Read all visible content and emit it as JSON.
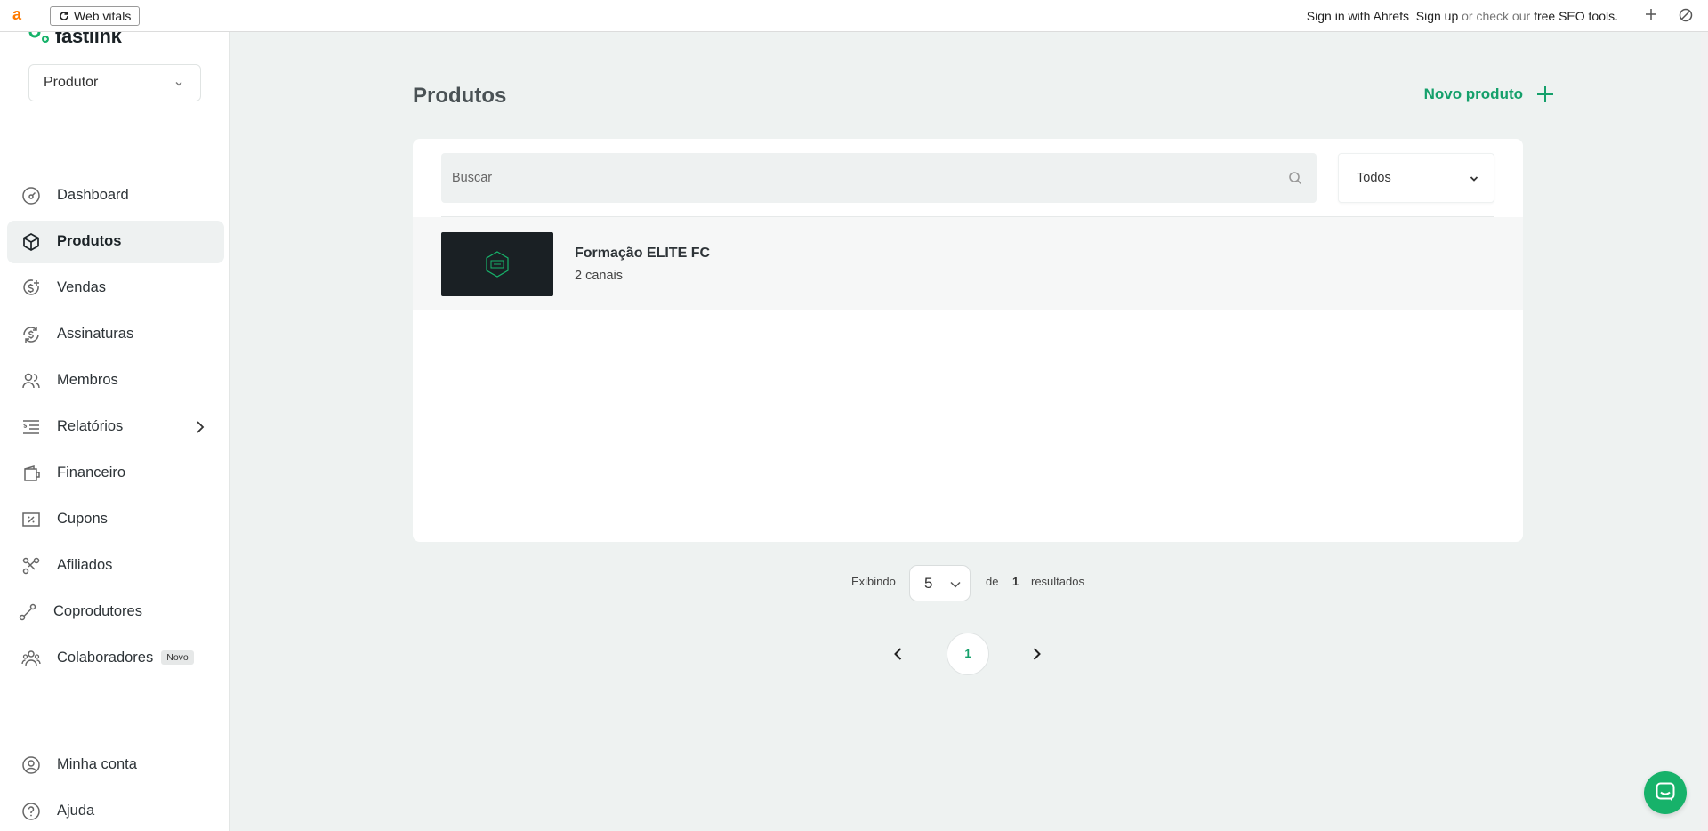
{
  "extension_bar": {
    "logo_letter": "a",
    "web_vitals_label": "Web vitals",
    "sign_in": "Sign in with Ahrefs",
    "sign_up": "Sign up",
    "or_check": "or check our",
    "free_tools": "free SEO tools."
  },
  "brand": {
    "name": "fastlink",
    "color": "#17b26a"
  },
  "sidebar": {
    "role_select": "Produtor",
    "items": [
      {
        "label": "Dashboard",
        "icon": "dashboard-icon"
      },
      {
        "label": "Produtos",
        "icon": "box-icon",
        "active": true
      },
      {
        "label": "Vendas",
        "icon": "dollar-plus-icon"
      },
      {
        "label": "Assinaturas",
        "icon": "dollar-refresh-icon"
      },
      {
        "label": "Membros",
        "icon": "users-icon"
      },
      {
        "label": "Relatórios",
        "icon": "list-icon",
        "has_submenu": true
      },
      {
        "label": "Financeiro",
        "icon": "wallet-icon"
      },
      {
        "label": "Cupons",
        "icon": "coupon-icon"
      },
      {
        "label": "Afiliados",
        "icon": "affiliates-icon"
      },
      {
        "label": "Coprodutores",
        "icon": "link-icon"
      },
      {
        "label": "Colaboradores",
        "icon": "team-icon",
        "badge": "Novo"
      }
    ],
    "bottom_items": [
      {
        "label": "Minha conta",
        "icon": "user-circle-icon"
      },
      {
        "label": "Ajuda",
        "icon": "help-circle-icon"
      }
    ]
  },
  "main": {
    "title": "Produtos",
    "new_product_label": "Novo produto",
    "search_placeholder": "Buscar",
    "filter_value": "Todos",
    "products": [
      {
        "name": "Formação ELITE FC",
        "subtitle": "2 canais"
      }
    ],
    "pagination": {
      "showing_label": "Exibindo",
      "per_page": "5",
      "of_label": "de",
      "total": "1",
      "results_label": "resultados",
      "current_page": "1"
    }
  },
  "colors": {
    "accent": "#15a06b",
    "chat_button": "#17b26a",
    "background": "#eef2f1"
  }
}
